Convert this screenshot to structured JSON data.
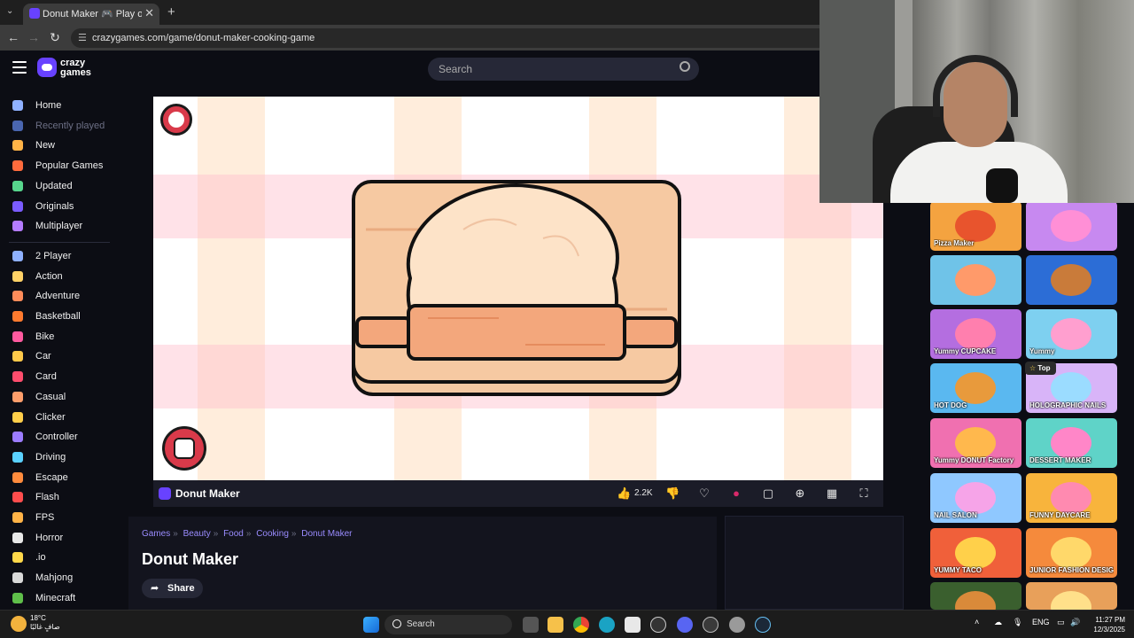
{
  "browser": {
    "tab_title": "Donut Maker 🎮 Play on CrazyGames",
    "new_tab": "+",
    "close": "✕",
    "url": "crazygames.com/game/donut-maker-cooking-game"
  },
  "site": {
    "logo_line1": "crazy",
    "logo_line2": "games",
    "search_placeholder": "Search"
  },
  "sidebar": {
    "primary": [
      {
        "label": "Home",
        "color": "#8fb1ff"
      },
      {
        "label": "Recently played",
        "color": "#4a66b0",
        "dim": true
      },
      {
        "label": "New",
        "color": "#ffb347"
      },
      {
        "label": "Popular Games",
        "color": "#ff6b3d"
      },
      {
        "label": "Updated",
        "color": "#57d68d"
      },
      {
        "label": "Originals",
        "color": "#7b5cff"
      },
      {
        "label": "Multiplayer",
        "color": "#b57cff"
      }
    ],
    "categories": [
      {
        "label": "2 Player",
        "color": "#8fb1ff"
      },
      {
        "label": "Action",
        "color": "#ffd166"
      },
      {
        "label": "Adventure",
        "color": "#ff8c5a"
      },
      {
        "label": "Basketball",
        "color": "#ff7a2f"
      },
      {
        "label": "Bike",
        "color": "#ff5aa0"
      },
      {
        "label": "Car",
        "color": "#ffc94a"
      },
      {
        "label": "Card",
        "color": "#ff4d6d"
      },
      {
        "label": "Casual",
        "color": "#ff9e6b"
      },
      {
        "label": "Clicker",
        "color": "#ffce4a"
      },
      {
        "label": "Controller",
        "color": "#9c7cff"
      },
      {
        "label": "Driving",
        "color": "#5ad1ff"
      },
      {
        "label": "Escape",
        "color": "#ff8b3d"
      },
      {
        "label": "Flash",
        "color": "#ff4d4d"
      },
      {
        "label": "FPS",
        "color": "#ffb347"
      },
      {
        "label": "Horror",
        "color": "#e8e8e8"
      },
      {
        "label": ".io",
        "color": "#ffd84a"
      },
      {
        "label": "Mahjong",
        "color": "#d9d9d9"
      },
      {
        "label": "Minecraft",
        "color": "#5fbf4a"
      }
    ]
  },
  "game": {
    "title": "Donut Maker",
    "likes": "2.2K"
  },
  "info": {
    "breadcrumbs": [
      "Games",
      "Beauty",
      "Food",
      "Cooking",
      "Donut Maker"
    ],
    "title": "Donut Maker",
    "share": "Share"
  },
  "thumbnails": [
    {
      "label": "Pizza Maker",
      "bg": "#f4a340",
      "accent": "#e8542d"
    },
    {
      "label": "",
      "bg": "#c789f0",
      "accent": "#ff8fd6"
    },
    {
      "label": "",
      "bg": "#6fc3e8",
      "accent": "#ff9a6a"
    },
    {
      "label": "",
      "bg": "#2c6dd6",
      "accent": "#c97b3a"
    },
    {
      "label": "Yummy CUPCAKE",
      "bg": "#b46ee0",
      "accent": "#ff7fae"
    },
    {
      "label": "Yummy",
      "bg": "#7ed0f0",
      "accent": "#ff9fcf"
    },
    {
      "label": "HOT DOG",
      "bg": "#5ab8f0",
      "accent": "#e89a3c"
    },
    {
      "label": "HOLOGRAPHIC NAILS",
      "bg": "#d8b4f8",
      "accent": "#9bdcff"
    },
    {
      "label": "Yummy DONUT Factory",
      "bg": "#f070b0",
      "accent": "#ffb84d"
    },
    {
      "label": "DESSERT MAKER",
      "bg": "#5fd3c8",
      "accent": "#ff86c8"
    },
    {
      "label": "NAIL SALON",
      "bg": "#8fc8ff",
      "accent": "#f6a4e8"
    },
    {
      "label": "FUNNY DAYCARE",
      "bg": "#f8b43c",
      "accent": "#ff8ab0"
    },
    {
      "label": "YUMMY TACO",
      "bg": "#f0603a",
      "accent": "#ffd04a"
    },
    {
      "label": "JUNIOR FASHION DESIGNER",
      "bg": "#f58a3c",
      "accent": "#ffd86a"
    },
    {
      "label": "",
      "bg": "#3a5f2e",
      "accent": "#d98a3a"
    },
    {
      "label": "",
      "bg": "#e8a05a",
      "accent": "#ffe08a"
    }
  ],
  "top_badge": "Top",
  "taskbar": {
    "temp": "18°C",
    "weather_desc": "صافٍ غالبًا",
    "search": "Search",
    "lang": "ENG",
    "time": "11:27 PM",
    "date": "12/3/2025"
  }
}
